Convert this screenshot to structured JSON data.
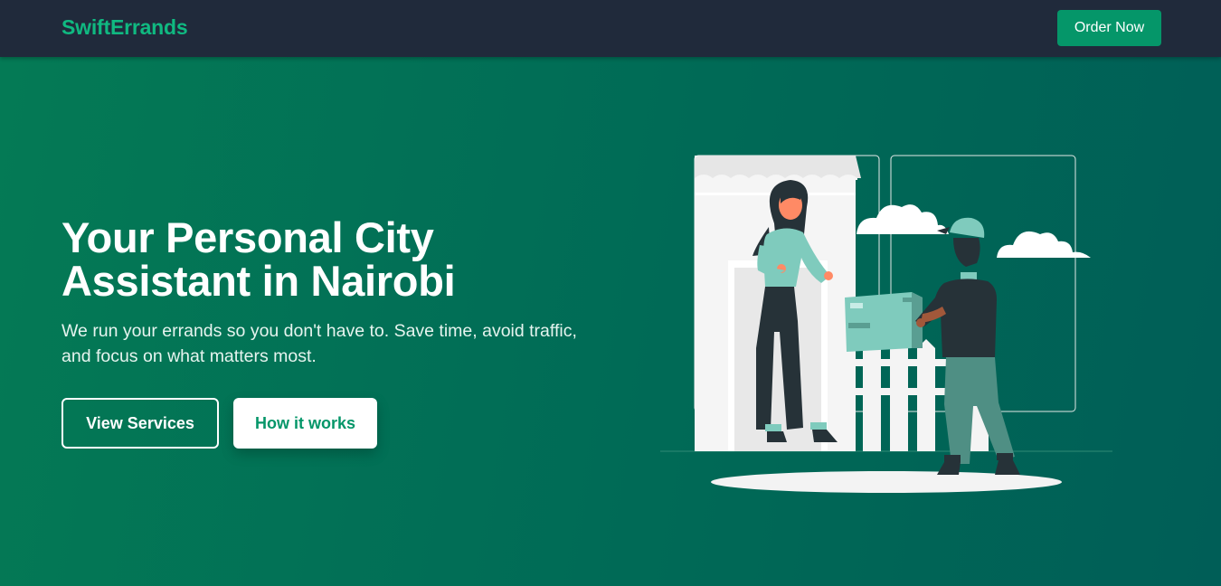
{
  "header": {
    "brand": "SwiftErrands",
    "cta_label": "Order Now"
  },
  "hero": {
    "title": "Your Personal City Assistant in Nairobi",
    "subtitle": "We run your errands so you don't have to. Save time, avoid traffic, and focus on what matters most.",
    "primary_button": "View Services",
    "secondary_button": "How it works",
    "illustration": "delivery-person-handing-package-to-woman"
  },
  "colors": {
    "nav_bg": "#202a3b",
    "brand": "#10b981",
    "accent": "#059669",
    "hero_start": "#047a55",
    "hero_end": "#005e57"
  }
}
